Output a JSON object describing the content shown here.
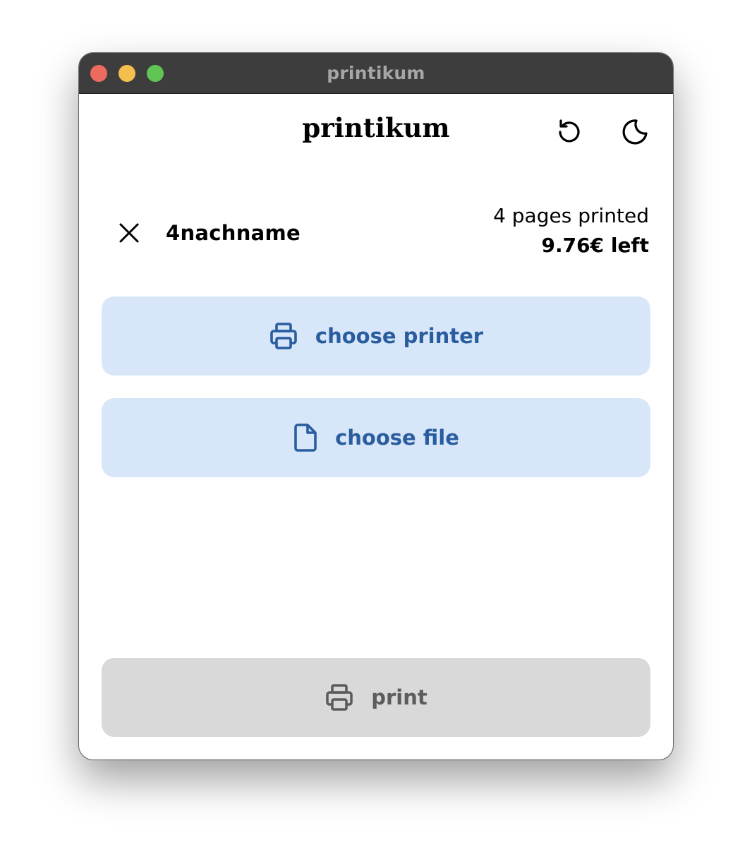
{
  "window": {
    "title": "printikum"
  },
  "header": {
    "app_title": "printikum",
    "refresh_icon": "refresh-icon",
    "theme_icon": "moon-icon"
  },
  "account": {
    "logout_icon": "close-icon",
    "username": "4nachname",
    "pages_printed": "4 pages printed",
    "balance": "9.76€ left"
  },
  "actions": {
    "choose_printer": "choose printer",
    "choose_file": "choose file",
    "print": "print"
  },
  "colors": {
    "accent_bg": "#d7e7f9",
    "accent_text": "#2a5d9f",
    "disabled_bg": "#d9d9d9",
    "disabled_text": "#5c5c5c"
  }
}
